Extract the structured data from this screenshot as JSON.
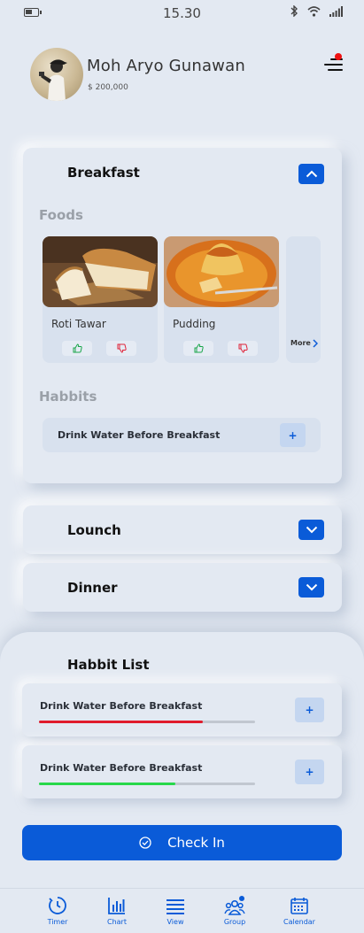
{
  "status_bar": {
    "time": "15.30"
  },
  "user": {
    "name": "Moh Aryo Gunawan",
    "balance": "$ 200,000"
  },
  "breakfast": {
    "title": "Breakfast",
    "foods_label": "Foods",
    "foods": [
      {
        "name": "Roti Tawar"
      },
      {
        "name": "Pudding"
      }
    ],
    "more_label": "More",
    "habbits_label": "Habbits",
    "habit": "Drink Water Before Breakfast",
    "habit_plus": "+"
  },
  "lounch": {
    "title": "Lounch"
  },
  "dinner": {
    "title": "Dinner"
  },
  "habbit_list": {
    "title": "Habbit List",
    "items": [
      {
        "label": "Drink Water Before Breakfast",
        "plus": "+",
        "progress": 0.76,
        "color": "#e01c2c"
      },
      {
        "label": "Drink Water Before Breakfast",
        "plus": "+",
        "progress": 0.63,
        "color": "#27d84a"
      }
    ]
  },
  "checkin": {
    "label": "Check In"
  },
  "nav": [
    {
      "label": "Timer",
      "icon": "timer-icon"
    },
    {
      "label": "Chart",
      "icon": "chart-icon"
    },
    {
      "label": "View",
      "icon": "view-list-icon"
    },
    {
      "label": "Group",
      "icon": "group-icon"
    },
    {
      "label": "Calendar",
      "icon": "calendar-icon"
    }
  ],
  "colors": {
    "accent": "#0a5bd8",
    "background": "#e3e9f2",
    "notification": "#e11111"
  }
}
